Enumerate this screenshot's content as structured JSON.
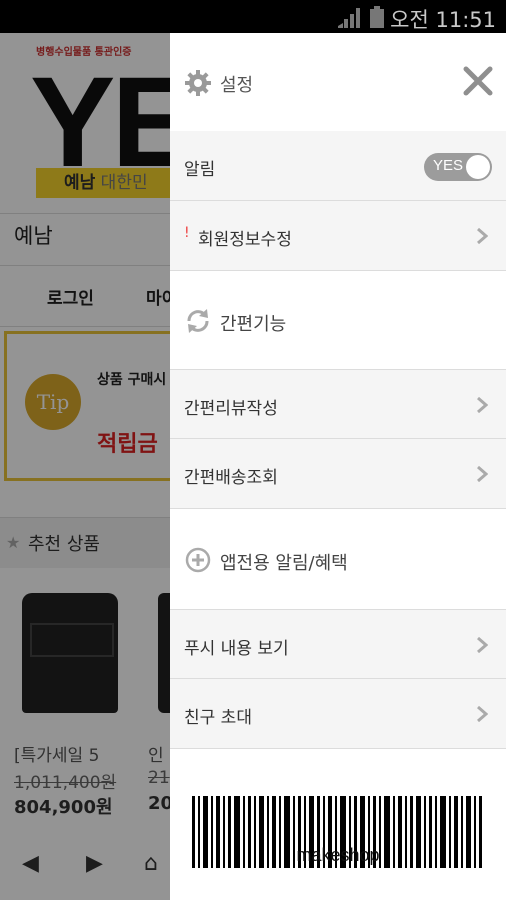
{
  "status_bar": {
    "time": "오전 11:51"
  },
  "background_page": {
    "logo_subtitle": "병행수입물품 통관인증",
    "logo": "YE",
    "logo_band_bold": "예남",
    "logo_band_rest": " 대한민",
    "shop_name": "예남",
    "menu": [
      "로그인",
      "마이"
    ],
    "tip_badge": "Tip",
    "tip_line1": "상품 구매시",
    "tip_line2": "적립금",
    "recommend_title": "추천 상품",
    "products": [
      {
        "name": "[특가세일 5",
        "old_price": "1,011,400원",
        "price": "804,900원"
      },
      {
        "name": "인",
        "old_price": "21",
        "price": "20"
      }
    ]
  },
  "drawer": {
    "title": "설정",
    "notification": {
      "label": "알림",
      "toggle": "YES"
    },
    "member_edit": {
      "label": "회원정보수정"
    },
    "quick_section": {
      "title": "간편기능"
    },
    "quick_items": [
      "간편리뷰작성",
      "간편배송조회"
    ],
    "app_section": {
      "title": "앱전용 알림/혜택"
    },
    "app_items": [
      "푸시 내용 보기",
      "친구 초대"
    ],
    "barcode_label": "makeshop"
  }
}
